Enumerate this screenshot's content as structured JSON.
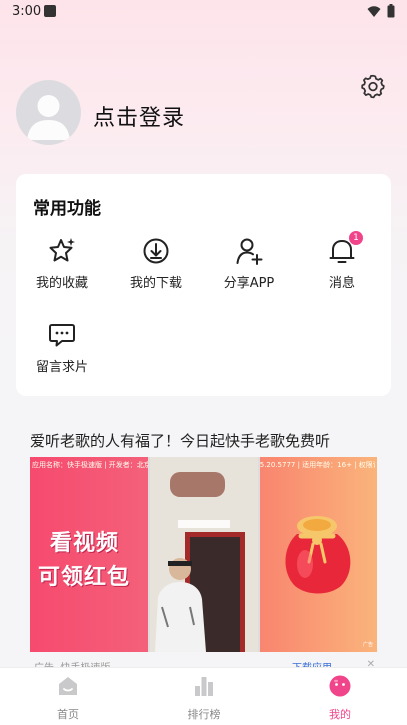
{
  "status_bar": {
    "time": "3:00"
  },
  "profile": {
    "login_label": "点击登录"
  },
  "functions": {
    "title": "常用功能",
    "items": [
      {
        "label": "我的收藏",
        "icon": "star-sparkle-icon"
      },
      {
        "label": "我的下载",
        "icon": "download-icon"
      },
      {
        "label": "分享APP",
        "icon": "user-add-icon"
      },
      {
        "label": "消息",
        "icon": "bell-icon",
        "badge": "1"
      },
      {
        "label": "留言求片",
        "icon": "message-bubble-icon"
      }
    ]
  },
  "promo": {
    "title": "爱听老歌的人有福了！今日起快手老歌免费听",
    "ad": {
      "top_text": "应用名称：快手极速版 | 开发者：北京快手科技有限公司 | 应用版本：11.5.20.5777 | 适用年龄：16+ | 权限详情 | 隐私协议 | 功能介绍 | 备案信息",
      "headline_1": "看视频",
      "headline_2": "可领红包",
      "bottom_text": "广告"
    },
    "meta": {
      "source": "快手极速版",
      "ad_label": "广告",
      "download_label": "下载应用",
      "close": "✕"
    }
  },
  "bottom_nav": {
    "items": [
      {
        "label": "首页",
        "icon": "home-icon",
        "active": false
      },
      {
        "label": "排行榜",
        "icon": "rank-chart-icon",
        "active": false
      },
      {
        "label": "我的",
        "icon": "profile-face-icon",
        "active": true
      }
    ]
  },
  "colors": {
    "accent": "#f0458a",
    "badge": "#f0458a",
    "nav_inactive": "#888888"
  }
}
